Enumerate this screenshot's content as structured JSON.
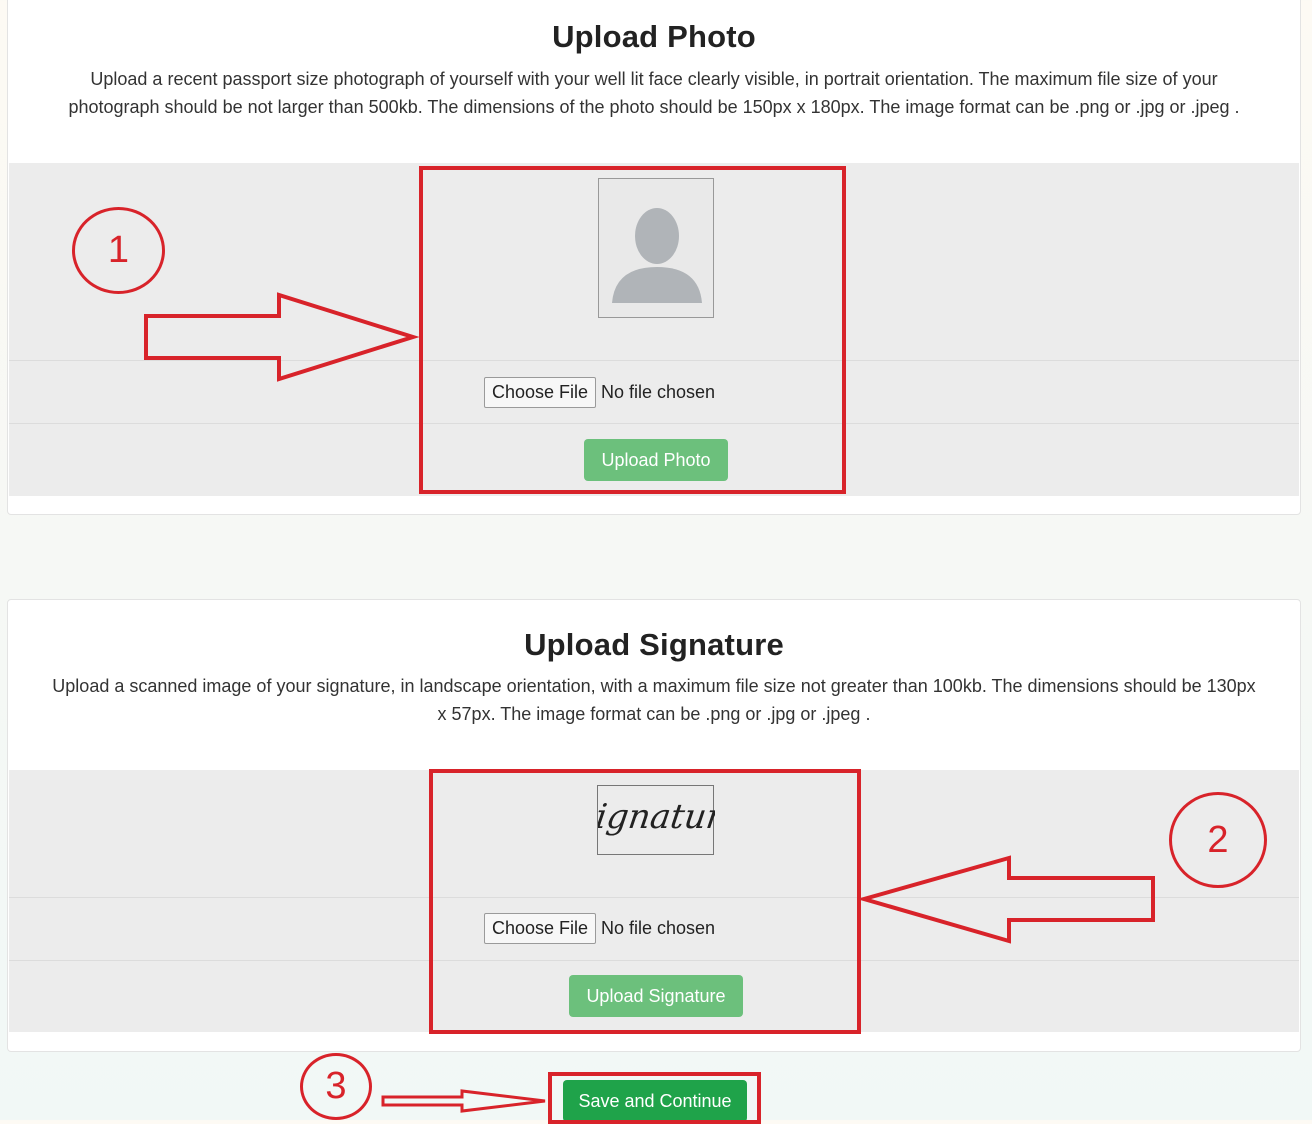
{
  "photo_section": {
    "title": "Upload Photo",
    "description_line1": "Upload a recent passport size photograph of yourself with your well lit face clearly visible, in portrait orientation. The maximum file size of your",
    "description_line2": "photograph should be not larger than 500kb. The dimensions of the photo should be 150px x 180px. The image format can be .png or .jpg or .jpeg .",
    "choose_file_label": "Choose File",
    "file_status": "No file chosen",
    "upload_button": "Upload Photo"
  },
  "signature_section": {
    "title": "Upload Signature",
    "description_line1": "Upload a scanned image of your signature, in landscape orientation, with a maximum file size not greater than 100kb. The dimensions should be 130px",
    "description_line2": "x 57px. The image format can be .png or .jpg or .jpeg .",
    "sample_signature_text": "Signature",
    "choose_file_label": "Choose File",
    "file_status": "No file chosen",
    "upload_button": "Upload Signature"
  },
  "save_button": "Save and Continue",
  "annotations": {
    "step1": "1",
    "step2": "2",
    "step3": "3",
    "color": "#d8232a"
  },
  "colors": {
    "upload_button": "#6cc07c",
    "save_button": "#1fa34a",
    "panel_gray": "#ececec"
  },
  "icons": {
    "placeholder": "person-silhouette-icon"
  }
}
